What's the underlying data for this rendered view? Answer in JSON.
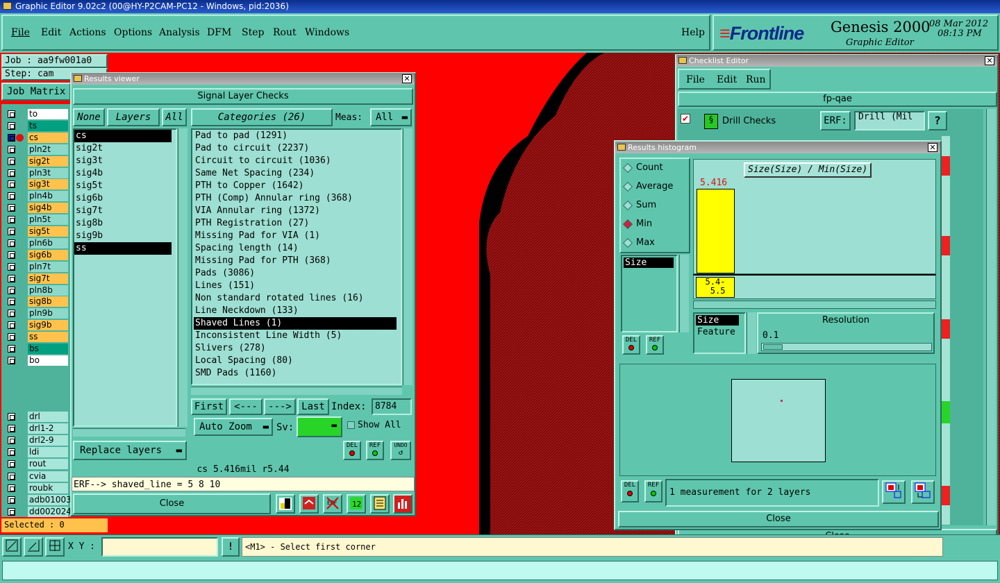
{
  "window": {
    "title": "Graphic Editor 9.02c2 (00@HY-P2CAM-PC12 - Windows, pid:2036)"
  },
  "menubar": {
    "items": [
      "File",
      "Edit",
      "Actions",
      "Options",
      "Analysis",
      "DFM",
      "Step",
      "Rout",
      "Windows"
    ],
    "help": "Help"
  },
  "brand": {
    "logo": "Frontline",
    "product": "Genesis 2000",
    "subtitle": "Graphic Editor",
    "date": "08 Mar 2012",
    "time": "08:13 PM"
  },
  "job": {
    "job": "Job : aa9fw001a0",
    "step": "Step: cam",
    "matrix_button": "Job Matrix"
  },
  "layers": [
    {
      "name": "to",
      "color": "#ffffff"
    },
    {
      "name": "ts",
      "color": "#00a080"
    },
    {
      "name": "cs",
      "color": "#ffc34d"
    },
    {
      "name": "pln2t",
      "color": "#8cd9ca"
    },
    {
      "name": "sig2t",
      "color": "#ffc34d"
    },
    {
      "name": "pln3t",
      "color": "#8cd9ca"
    },
    {
      "name": "sig3t",
      "color": "#ffc34d"
    },
    {
      "name": "pln4b",
      "color": "#8cd9ca"
    },
    {
      "name": "sig4b",
      "color": "#ffc34d"
    },
    {
      "name": "pln5t",
      "color": "#8cd9ca"
    },
    {
      "name": "sig5t",
      "color": "#ffc34d"
    },
    {
      "name": "pln6b",
      "color": "#8cd9ca"
    },
    {
      "name": "sig6b",
      "color": "#ffc34d"
    },
    {
      "name": "pln7t",
      "color": "#8cd9ca"
    },
    {
      "name": "sig7t",
      "color": "#ffc34d"
    },
    {
      "name": "pln8b",
      "color": "#8cd9ca"
    },
    {
      "name": "sig8b",
      "color": "#ffc34d"
    },
    {
      "name": "pln9b",
      "color": "#8cd9ca"
    },
    {
      "name": "sig9b",
      "color": "#ffc34d"
    },
    {
      "name": "ss",
      "color": "#ffc34d"
    },
    {
      "name": "bs",
      "color": "#00a080"
    },
    {
      "name": "bo",
      "color": "#ffffff"
    }
  ],
  "drill_layers": [
    {
      "name": "drl",
      "color": "#a8e6da"
    },
    {
      "name": "drl1-2",
      "color": "#a8e6da"
    },
    {
      "name": "drl2-9",
      "color": "#a8e6da"
    },
    {
      "name": "ldi",
      "color": "#a8e6da"
    },
    {
      "name": "rout",
      "color": "#a8e6da"
    }
  ],
  "misc_layers": [
    {
      "name": "cvia",
      "color": "#a8e6da"
    },
    {
      "name": "roubk",
      "color": "#a8e6da"
    },
    {
      "name": "adb01003",
      "color": "#a8e6da"
    },
    {
      "name": "dd002024",
      "color": "#a8e6da"
    }
  ],
  "selected": "Selected : 0",
  "results_viewer": {
    "title": "Results viewer",
    "header": "Signal Layer Checks",
    "none_btn": "None",
    "layers_btn": "Layers",
    "all_btn": "All",
    "categories_btn": "Categories (26)",
    "meas_label": "Meas:",
    "meas_value": "All",
    "layers": [
      "cs",
      "sig2t",
      "sig3t",
      "sig4b",
      "sig5t",
      "sig6b",
      "sig7t",
      "sig8b",
      "sig9b",
      "ss"
    ],
    "categories": [
      "Pad to pad (1291)",
      "Pad to circuit (2237)",
      "Circuit to circuit (1036)",
      "Same Net Spacing (234)",
      "PTH to Copper (1642)",
      "PTH (Comp) Annular ring (368)",
      "VIA Annular ring (1372)",
      "PTH Registration (27)",
      "Missing Pad for VIA (1)",
      "Spacing length (14)",
      "Missing Pad for PTH (368)",
      "Pads (3086)",
      "Lines (151)",
      "Non standard rotated lines (16)",
      "Line Neckdown (133)",
      "Shaved Lines (1)",
      "Inconsistent Line Width (5)",
      "Slivers (278)",
      "Local Spacing (80)",
      "SMD Pads (1160)"
    ],
    "nav": {
      "first": "First",
      "prev": "<---",
      "next": "--->",
      "last": "Last",
      "index_label": "Index:",
      "index_value": "8784"
    },
    "auto_zoom": "Auto Zoom",
    "sv_label": "Sv:",
    "show_all": "Show All",
    "replace_layers": "Replace layers",
    "del": "DEL",
    "ref": "REF",
    "erf": "ERF",
    "undo": "UNDO",
    "status": "cs 5.416mil  r5.44",
    "erf_line": "ERF--> shaved_line = 5 8 10",
    "close": "Close"
  },
  "checklist": {
    "title": "Checklist Editor",
    "menu": [
      "File",
      "Edit",
      "Run"
    ],
    "name": "fp-qae",
    "check_name": "Drill Checks",
    "erf_label": "ERF:",
    "erf_value": "Drill (Mil",
    "help": "?",
    "close": "Close"
  },
  "histogram": {
    "title": "Results histogram",
    "modes": [
      "Count",
      "Average",
      "Sum",
      "Min",
      "Max"
    ],
    "selected_mode": "Min",
    "measure_list": [
      "Size"
    ],
    "chart_title": "Size(Size) / Min(Size)",
    "bar_value": "5.416",
    "bar_range": "5.4-\n 5.5",
    "size_label": "Size",
    "feature_label": "Feature",
    "resolution_label": "Resolution",
    "resolution_value": "0.1",
    "del": "DEL",
    "ref": "REF",
    "message": "1 measurement for 2 layers",
    "close": "Close"
  },
  "bottom": {
    "xy_label": "X Y :",
    "xy_value": "",
    "alert": "!",
    "prompt": "<M1> - Select first corner"
  },
  "colors": {
    "teal": "#5fc6ad",
    "canvas_red": "#ff0000",
    "dark_red": "#6b0000"
  },
  "chart_data": {
    "type": "bar",
    "title": "Size(Size) / Min(Size)",
    "categories": [
      "5.4-5.5"
    ],
    "values": [
      5.416
    ]
  }
}
